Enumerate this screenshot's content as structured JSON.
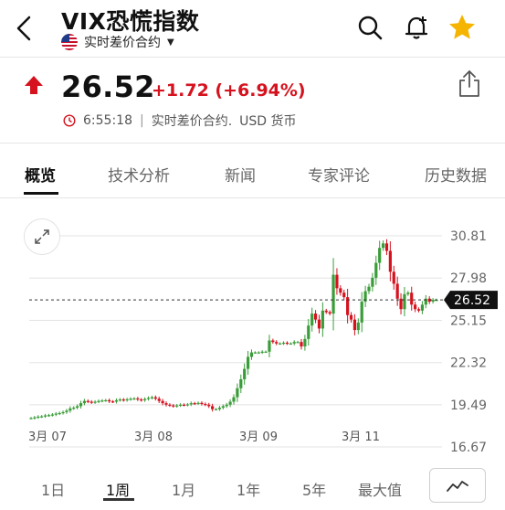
{
  "header": {
    "title": "VIX恐慌指数",
    "subtitle": "实时差价合约",
    "icons": [
      "back-icon",
      "search-icon",
      "add-alert-bell-icon",
      "star-icon"
    ],
    "star_color": "#f4b400"
  },
  "quote": {
    "price": "26.52",
    "change": "+1.72 (+6.94%)",
    "time": "6:55:18",
    "separator": "|",
    "instrument": "实时差价合约.",
    "currency": "USD 货币",
    "change_color": "#d5121e"
  },
  "tabs": [
    {
      "label": "概览",
      "active": true
    },
    {
      "label": "技术分析",
      "active": false
    },
    {
      "label": "新闻",
      "active": false
    },
    {
      "label": "专家评论",
      "active": false
    },
    {
      "label": "历史数据",
      "active": false
    }
  ],
  "chart_data": {
    "type": "candlestick",
    "y_ticks": [
      "30.81",
      "27.98",
      "25.15",
      "22.32",
      "19.49",
      "16.67"
    ],
    "x_ticks": [
      "3月 07",
      "3月 08",
      "3月 09",
      "3月 11"
    ],
    "ylim": [
      16.67,
      30.81
    ],
    "last_price": 26.52,
    "last_price_label": "26.52",
    "up_color": "#3a9d3a",
    "down_color": "#d5121e",
    "values": [
      18.6,
      18.65,
      18.7,
      18.72,
      18.78,
      18.8,
      18.84,
      18.9,
      18.94,
      19.0,
      19.1,
      19.25,
      19.3,
      19.4,
      19.6,
      19.75,
      19.7,
      19.65,
      19.7,
      19.75,
      19.78,
      19.8,
      19.72,
      19.7,
      19.8,
      19.85,
      19.8,
      19.86,
      19.9,
      19.92,
      19.85,
      19.8,
      19.88,
      19.95,
      20.0,
      19.9,
      19.75,
      19.6,
      19.5,
      19.45,
      19.4,
      19.45,
      19.5,
      19.48,
      19.52,
      19.6,
      19.58,
      19.62,
      19.55,
      19.5,
      19.4,
      19.2,
      19.2,
      19.3,
      19.4,
      19.5,
      19.7,
      20.0,
      20.6,
      21.2,
      21.9,
      22.7,
      23.0,
      23.0,
      23.0,
      23.05,
      23.05,
      23.8,
      23.7,
      23.6,
      23.6,
      23.65,
      23.6,
      23.6,
      23.7,
      23.7,
      23.4,
      23.9,
      24.8,
      25.6,
      25.2,
      24.6,
      25.8,
      25.7,
      25.6,
      28.2,
      27.3,
      27.0,
      26.7,
      25.5,
      25.2,
      24.5,
      25.0,
      26.4,
      27.1,
      27.4,
      28.0,
      29.0,
      30.0,
      30.3,
      29.8,
      28.4,
      27.6,
      26.6,
      25.9,
      26.9,
      27.0,
      26.2,
      25.9,
      25.8,
      26.2,
      26.6,
      26.4,
      26.52,
      26.52
    ]
  },
  "range_selector": [
    {
      "label": "1日",
      "active": false
    },
    {
      "label": "1周",
      "active": true
    },
    {
      "label": "1月",
      "active": false
    },
    {
      "label": "1年",
      "active": false
    },
    {
      "label": "5年",
      "active": false
    },
    {
      "label": "最大值",
      "active": false
    }
  ],
  "icons": {
    "expand": "expand-icon",
    "share": "share-icon",
    "chart_type": "line-chart-icon",
    "up_arrow": "up-arrow-icon",
    "clock": "clock-icon",
    "flag": "us-flag-icon"
  }
}
